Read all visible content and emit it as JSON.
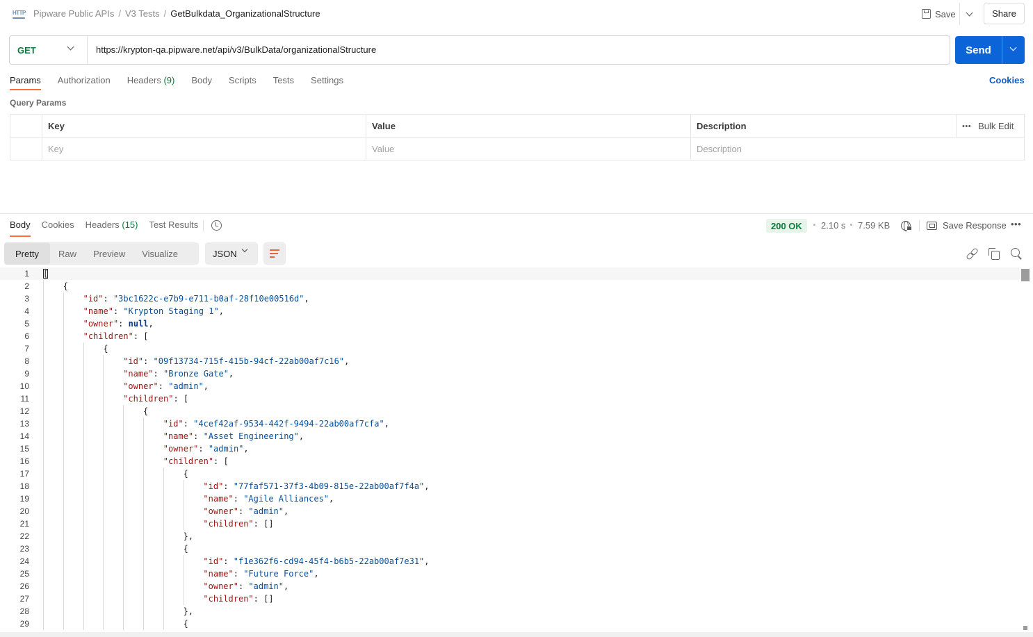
{
  "breadcrumb": {
    "icon": "http-icon",
    "items": [
      "Pipware Public APIs",
      "V3 Tests"
    ],
    "current": "GetBulkdata_OrganizationalStructure",
    "separator": "/"
  },
  "header_actions": {
    "save_label": "Save",
    "share_label": "Share"
  },
  "request": {
    "method": "GET",
    "url": "https://krypton-qa.pipware.net/api/v3/BulkData/organizationalStructure",
    "send_label": "Send",
    "method_color": "#0b7a3e",
    "send_color": "#0b65d8"
  },
  "request_tabs": [
    {
      "label": "Params",
      "count": "",
      "active": true
    },
    {
      "label": "Authorization",
      "count": "",
      "active": false
    },
    {
      "label": "Headers",
      "count": "(9)",
      "active": false
    },
    {
      "label": "Body",
      "count": "",
      "active": false
    },
    {
      "label": "Scripts",
      "count": "",
      "active": false
    },
    {
      "label": "Tests",
      "count": "",
      "active": false
    },
    {
      "label": "Settings",
      "count": "",
      "active": false
    }
  ],
  "cookies_link": "Cookies",
  "query_params": {
    "title": "Query Params",
    "headers": {
      "key": "Key",
      "value": "Value",
      "description": "Description",
      "bulk_edit": "Bulk Edit"
    },
    "placeholders": {
      "key": "Key",
      "value": "Value",
      "description": "Description"
    }
  },
  "response_tabs": [
    {
      "label": "Body",
      "count": "",
      "active": true
    },
    {
      "label": "Cookies",
      "count": "",
      "active": false
    },
    {
      "label": "Headers",
      "count": "(15)",
      "active": false
    },
    {
      "label": "Test Results",
      "count": "",
      "active": false
    }
  ],
  "response_meta": {
    "status": "200 OK",
    "time": "2.10 s",
    "size": "7.59 KB",
    "save_response_label": "Save Response",
    "status_color": "#0b7a3e"
  },
  "view_modes": [
    {
      "label": "Pretty",
      "active": true
    },
    {
      "label": "Raw",
      "active": false
    },
    {
      "label": "Preview",
      "active": false
    },
    {
      "label": "Visualize",
      "active": false
    }
  ],
  "format": "JSON",
  "code_lines": [
    {
      "n": "1",
      "indent": 0,
      "tokens": [
        [
          "p",
          "["
        ]
      ]
    },
    {
      "n": "2",
      "indent": 1,
      "tokens": [
        [
          "p",
          "{"
        ]
      ]
    },
    {
      "n": "3",
      "indent": 2,
      "tokens": [
        [
          "k",
          "\"id\""
        ],
        [
          "p",
          ": "
        ],
        [
          "s",
          "\"3bc1622c-e7b9-e711-b0af-28f10e00516d\""
        ],
        [
          "p",
          ","
        ]
      ]
    },
    {
      "n": "4",
      "indent": 2,
      "tokens": [
        [
          "k",
          "\"name\""
        ],
        [
          "p",
          ": "
        ],
        [
          "s",
          "\"Krypton Staging 1\""
        ],
        [
          "p",
          ","
        ]
      ]
    },
    {
      "n": "5",
      "indent": 2,
      "tokens": [
        [
          "k",
          "\"owner\""
        ],
        [
          "p",
          ": "
        ],
        [
          "kw",
          "null"
        ],
        [
          "p",
          ","
        ]
      ]
    },
    {
      "n": "6",
      "indent": 2,
      "tokens": [
        [
          "k",
          "\"children\""
        ],
        [
          "p",
          ": ["
        ]
      ]
    },
    {
      "n": "7",
      "indent": 3,
      "tokens": [
        [
          "p",
          "{"
        ]
      ]
    },
    {
      "n": "8",
      "indent": 4,
      "tokens": [
        [
          "k",
          "\"id\""
        ],
        [
          "p",
          ": "
        ],
        [
          "s",
          "\"09f13734-715f-415b-94cf-22ab00af7c16\""
        ],
        [
          "p",
          ","
        ]
      ]
    },
    {
      "n": "9",
      "indent": 4,
      "tokens": [
        [
          "k",
          "\"name\""
        ],
        [
          "p",
          ": "
        ],
        [
          "s",
          "\"Bronze Gate\""
        ],
        [
          "p",
          ","
        ]
      ]
    },
    {
      "n": "10",
      "indent": 4,
      "tokens": [
        [
          "k",
          "\"owner\""
        ],
        [
          "p",
          ": "
        ],
        [
          "s",
          "\"admin\""
        ],
        [
          "p",
          ","
        ]
      ]
    },
    {
      "n": "11",
      "indent": 4,
      "tokens": [
        [
          "k",
          "\"children\""
        ],
        [
          "p",
          ": ["
        ]
      ]
    },
    {
      "n": "12",
      "indent": 5,
      "tokens": [
        [
          "p",
          "{"
        ]
      ]
    },
    {
      "n": "13",
      "indent": 6,
      "tokens": [
        [
          "k",
          "\"id\""
        ],
        [
          "p",
          ": "
        ],
        [
          "s",
          "\"4cef42af-9534-442f-9494-22ab00af7cfa\""
        ],
        [
          "p",
          ","
        ]
      ]
    },
    {
      "n": "14",
      "indent": 6,
      "tokens": [
        [
          "k",
          "\"name\""
        ],
        [
          "p",
          ": "
        ],
        [
          "s",
          "\"Asset Engineering\""
        ],
        [
          "p",
          ","
        ]
      ]
    },
    {
      "n": "15",
      "indent": 6,
      "tokens": [
        [
          "k",
          "\"owner\""
        ],
        [
          "p",
          ": "
        ],
        [
          "s",
          "\"admin\""
        ],
        [
          "p",
          ","
        ]
      ]
    },
    {
      "n": "16",
      "indent": 6,
      "tokens": [
        [
          "k",
          "\"children\""
        ],
        [
          "p",
          ": ["
        ]
      ]
    },
    {
      "n": "17",
      "indent": 7,
      "tokens": [
        [
          "p",
          "{"
        ]
      ]
    },
    {
      "n": "18",
      "indent": 8,
      "tokens": [
        [
          "k",
          "\"id\""
        ],
        [
          "p",
          ": "
        ],
        [
          "s",
          "\"77faf571-37f3-4b09-815e-22ab00af7f4a\""
        ],
        [
          "p",
          ","
        ]
      ]
    },
    {
      "n": "19",
      "indent": 8,
      "tokens": [
        [
          "k",
          "\"name\""
        ],
        [
          "p",
          ": "
        ],
        [
          "s",
          "\"Agile Alliances\""
        ],
        [
          "p",
          ","
        ]
      ]
    },
    {
      "n": "20",
      "indent": 8,
      "tokens": [
        [
          "k",
          "\"owner\""
        ],
        [
          "p",
          ": "
        ],
        [
          "s",
          "\"admin\""
        ],
        [
          "p",
          ","
        ]
      ]
    },
    {
      "n": "21",
      "indent": 8,
      "tokens": [
        [
          "k",
          "\"children\""
        ],
        [
          "p",
          ": []"
        ]
      ]
    },
    {
      "n": "22",
      "indent": 7,
      "tokens": [
        [
          "p",
          "},"
        ]
      ]
    },
    {
      "n": "23",
      "indent": 7,
      "tokens": [
        [
          "p",
          "{"
        ]
      ]
    },
    {
      "n": "24",
      "indent": 8,
      "tokens": [
        [
          "k",
          "\"id\""
        ],
        [
          "p",
          ": "
        ],
        [
          "s",
          "\"f1e362f6-cd94-45f4-b6b5-22ab00af7e31\""
        ],
        [
          "p",
          ","
        ]
      ]
    },
    {
      "n": "25",
      "indent": 8,
      "tokens": [
        [
          "k",
          "\"name\""
        ],
        [
          "p",
          ": "
        ],
        [
          "s",
          "\"Future Force\""
        ],
        [
          "p",
          ","
        ]
      ]
    },
    {
      "n": "26",
      "indent": 8,
      "tokens": [
        [
          "k",
          "\"owner\""
        ],
        [
          "p",
          ": "
        ],
        [
          "s",
          "\"admin\""
        ],
        [
          "p",
          ","
        ]
      ]
    },
    {
      "n": "27",
      "indent": 8,
      "tokens": [
        [
          "k",
          "\"children\""
        ],
        [
          "p",
          ": []"
        ]
      ]
    },
    {
      "n": "28",
      "indent": 7,
      "tokens": [
        [
          "p",
          "},"
        ]
      ]
    },
    {
      "n": "29",
      "indent": 7,
      "tokens": [
        [
          "p",
          "{"
        ]
      ]
    }
  ]
}
